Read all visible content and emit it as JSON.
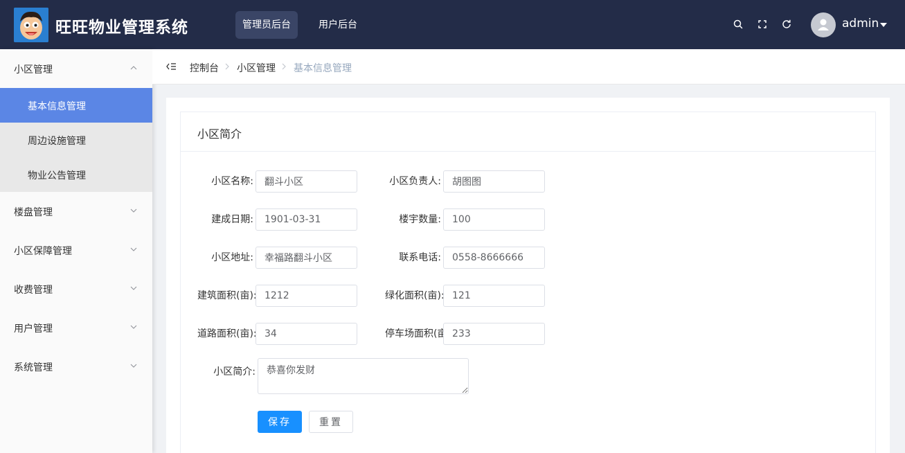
{
  "header": {
    "title": "旺旺物业管理系统",
    "tabs": [
      {
        "label": "管理员后台",
        "active": true
      },
      {
        "label": "用户后台",
        "active": false
      }
    ],
    "icons": [
      "search-icon",
      "fullscreen-icon",
      "refresh-icon"
    ],
    "username": "admin"
  },
  "sidebar": {
    "items": [
      {
        "label": "小区管理",
        "expanded": true,
        "children": [
          {
            "label": "基本信息管理",
            "active": true
          },
          {
            "label": "周边设施管理",
            "active": false
          },
          {
            "label": "物业公告管理",
            "active": false
          }
        ]
      },
      {
        "label": "楼盘管理"
      },
      {
        "label": "小区保障管理"
      },
      {
        "label": "收费管理"
      },
      {
        "label": "用户管理"
      },
      {
        "label": "系统管理"
      }
    ]
  },
  "breadcrumb": [
    "控制台",
    "小区管理",
    "基本信息管理"
  ],
  "card": {
    "title": "小区简介"
  },
  "form": {
    "fields": [
      {
        "label": "小区名称:",
        "value": "翻斗小区"
      },
      {
        "label": "小区负责人:",
        "value": "胡图图"
      },
      {
        "label": "建成日期:",
        "value": "1901-03-31"
      },
      {
        "label": "楼宇数量:",
        "value": "100"
      },
      {
        "label": "小区地址:",
        "value": "幸福路翻斗小区"
      },
      {
        "label": "联系电话:",
        "value": "0558-8666666"
      },
      {
        "label": "建筑面积(亩):",
        "value": "1212"
      },
      {
        "label": "绿化面积(亩):",
        "value": "121"
      },
      {
        "label": "道路面积(亩):",
        "value": "34"
      },
      {
        "label": "停车场面积(亩):",
        "value": "233"
      }
    ],
    "intro": {
      "label": "小区简介:",
      "value": "恭喜你发财"
    },
    "save_label": "保存",
    "reset_label": "重置"
  },
  "colors": {
    "header_bg": "#232c48",
    "active_menu": "#5b86e5",
    "primary_button": "#1890ff"
  }
}
